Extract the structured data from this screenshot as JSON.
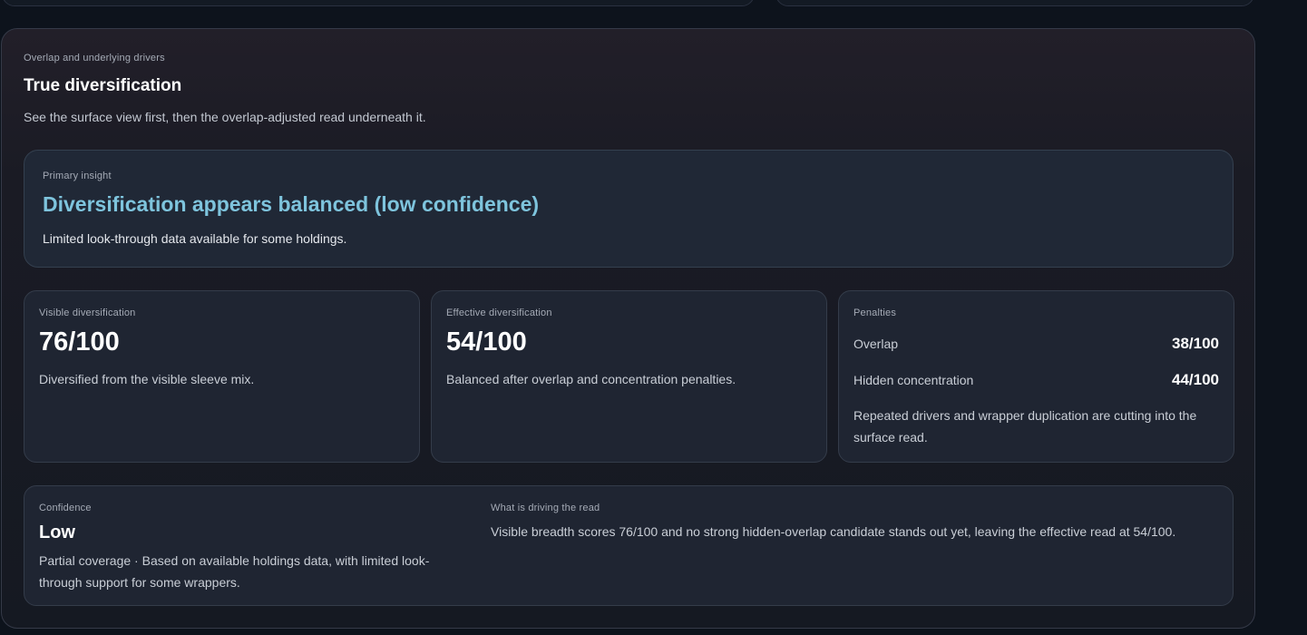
{
  "section": {
    "eyebrow": "Overlap and underlying drivers",
    "title": "True diversification",
    "description": "See the surface view first, then the overlap-adjusted read underneath it."
  },
  "insight": {
    "label": "Primary insight",
    "headline": "Diversification appears balanced (low confidence)",
    "detail": "Limited look-through data available for some holdings.",
    "accent_color": "#7ec4dd"
  },
  "visible": {
    "label": "Visible diversification",
    "score": "76/100",
    "text": "Diversified from the visible sleeve mix."
  },
  "effective": {
    "label": "Effective diversification",
    "score": "54/100",
    "text": "Balanced after overlap and concentration penalties."
  },
  "penalties": {
    "label": "Penalties",
    "rows": [
      {
        "name": "Overlap",
        "value": "38/100"
      },
      {
        "name": "Hidden concentration",
        "value": "44/100"
      }
    ],
    "text": "Repeated drivers and wrapper duplication are cutting into the surface read."
  },
  "confidence": {
    "label": "Confidence",
    "value": "Low",
    "text": "Partial coverage · Based on available holdings data, with limited look-through support for some wrappers."
  },
  "driver": {
    "label": "What is driving the read",
    "text": "Visible breadth scores 76/100 and no strong hidden-overlap candidate stands out yet, leaving the effective read at 54/100."
  }
}
